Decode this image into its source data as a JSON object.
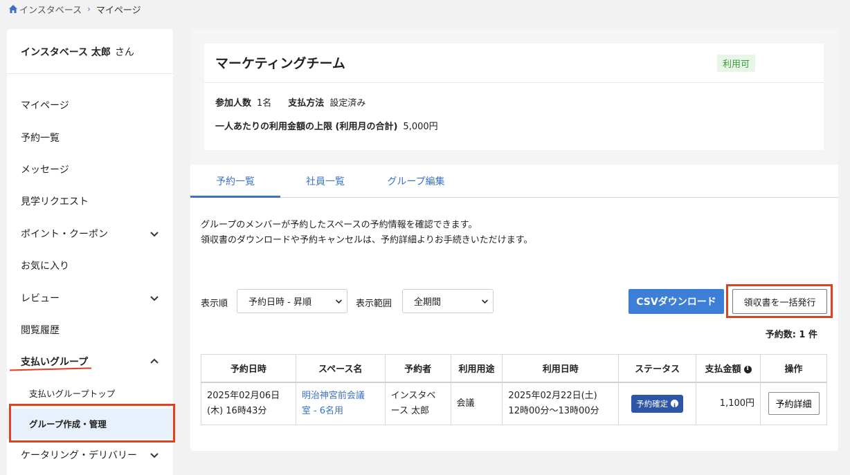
{
  "breadcrumb": {
    "home": "インスタベース",
    "current": "マイページ"
  },
  "user": {
    "name": "インスタベース 太郎",
    "suffix": "さん"
  },
  "sidebar": {
    "items": [
      {
        "label": "マイページ"
      },
      {
        "label": "予約一覧"
      },
      {
        "label": "メッセージ"
      },
      {
        "label": "見学リクエスト"
      },
      {
        "label": "ポイント・クーポン"
      },
      {
        "label": "お気に入り"
      },
      {
        "label": "レビュー"
      },
      {
        "label": "閲覧履歴"
      },
      {
        "label": "支払いグループ"
      },
      {
        "label": "ケータリング・デリバリー"
      }
    ],
    "sub_items": [
      {
        "label": "支払いグループトップ"
      },
      {
        "label": "グループ作成・管理"
      }
    ]
  },
  "group": {
    "name": "マーケティングチーム",
    "status": "利用可",
    "participants_label": "参加人数",
    "participants_value": "1名",
    "payment_label": "支払方法",
    "payment_value": "設定済み",
    "limit_label": "一人あたりの利用金額の上限 (利用月の合計)",
    "limit_value": "5,000円"
  },
  "tabs": [
    "予約一覧",
    "社員一覧",
    "グループ編集"
  ],
  "description": {
    "line1": "グループのメンバーが予約したスペースの予約情報を確認できます。",
    "line2": "領収書のダウンロードや予約キャンセルは、予約詳細よりお手続きいただけます。"
  },
  "controls": {
    "sort_label": "表示順",
    "sort_value": "予約日時 - 昇順",
    "range_label": "表示範囲",
    "range_value": "全期間",
    "csv_button": "CSVダウンロード",
    "receipt_button": "領収書を一括発行",
    "count": "予約数: 1 件"
  },
  "table": {
    "headers": [
      "予約日時",
      "スペース名",
      "予約者",
      "利用用途",
      "利用日時",
      "ステータス",
      "支払金額",
      "操作"
    ],
    "rows": [
      {
        "reserved_at_1": "2025年02月06日",
        "reserved_at_2": "(木) 16時43分",
        "space_1": "明治神宮前会議",
        "space_2": "室 - 6名用",
        "reserver_1": "インスタベ",
        "reserver_2": "ース 太郎",
        "purpose": "会議",
        "use_1": "2025年02月22日(土)",
        "use_2": "12時00分〜13時00分",
        "status": "予約確定",
        "amount": "1,100円",
        "action": "予約詳細"
      }
    ]
  },
  "colors": {
    "accent": "#3d7fd6",
    "highlight": "#e0421f",
    "status_badge": "#2e56a6",
    "available": "#3a9a3a"
  }
}
